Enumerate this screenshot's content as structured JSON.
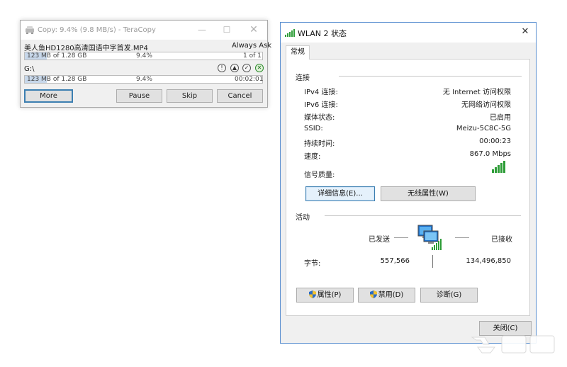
{
  "teracopy": {
    "title": "Copy: 9.4%  (9.8 MB/s) - TeraCopy",
    "file_name": "美人鱼HD1280高清国语中字首发.MP4",
    "overwrite_mode": "Always Ask",
    "file_bar": {
      "progress": 0.094,
      "sizes": "123 MB of 1.28 GB",
      "percent": "9.4%",
      "count": "1 of 1"
    },
    "destination": "G:\\",
    "total_bar": {
      "progress": 0.094,
      "sizes": "123 MB of 1.28 GB",
      "percent": "9.4%",
      "time": "00:02:01"
    },
    "buttons": {
      "more": "More",
      "pause": "Pause",
      "skip": "Skip",
      "cancel": "Cancel"
    },
    "icons": [
      "copy-app-icon",
      "info-icon",
      "up-icon",
      "check-icon",
      "check-green-icon"
    ]
  },
  "wlan": {
    "title": "WLAN 2 状态",
    "tab_general": "常规",
    "connection": {
      "header": "连接",
      "rows": [
        {
          "label": "IPv4 连接:",
          "value": "无 Internet 访问权限"
        },
        {
          "label": "IPv6 连接:",
          "value": "无网络访问权限"
        },
        {
          "label": "媒体状态:",
          "value": "已启用"
        },
        {
          "label": "SSID:",
          "value": "Meizu-5C8C-5G"
        },
        {
          "label": "持续时间:",
          "value": "00:00:23"
        },
        {
          "label": "速度:",
          "value": "867.0 Mbps"
        }
      ],
      "signal_label": "信号质量:",
      "signal_bars": 5,
      "details_button": "详细信息(E)...",
      "wireless_props_button": "无线属性(W)"
    },
    "activity": {
      "header": "活动",
      "sent_label": "已发送",
      "received_label": "已接收",
      "bytes_label": "字节:",
      "bytes_sent": "557,566",
      "bytes_received": "134,496,850"
    },
    "buttons": {
      "properties": "属性(P)",
      "disable": "禁用(D)",
      "diagnose": "诊断(G)",
      "close": "关闭(C)"
    },
    "colors": {
      "accent": "#3c7fb1",
      "signal": "#2e9d38"
    }
  }
}
